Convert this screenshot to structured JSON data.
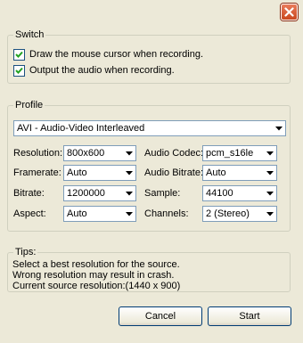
{
  "switch": {
    "legend": "Switch",
    "options": [
      {
        "label": "Draw the mouse cursor when recording.",
        "checked": true
      },
      {
        "label": "Output the audio when recording.",
        "checked": true
      }
    ]
  },
  "profile": {
    "legend": "Profile",
    "format": "AVI - Audio-Video Interleaved",
    "resolution": {
      "label": "Resolution:",
      "value": "800x600"
    },
    "framerate": {
      "label": "Framerate:",
      "value": "Auto"
    },
    "bitrate": {
      "label": "Bitrate:",
      "value": "1200000"
    },
    "aspect": {
      "label": "Aspect:",
      "value": "Auto"
    },
    "audio_codec": {
      "label": "Audio Codec:",
      "value": "pcm_s16le"
    },
    "audio_bitrate": {
      "label": "Audio Bitrate:",
      "value": "Auto"
    },
    "sample": {
      "label": "Sample:",
      "value": "44100"
    },
    "channels": {
      "label": "Channels:",
      "value": "2 (Stereo)"
    }
  },
  "tips": {
    "legend": "Tips:",
    "lines": [
      "Select a best resolution for the source.",
      "Wrong resolution may result in crash.",
      "Current source resolution:(1440 x 900)"
    ]
  },
  "buttons": {
    "cancel": "Cancel",
    "start": "Start"
  },
  "icons": {
    "close": "close-icon",
    "checkbox": "checkmark-icon",
    "dropdown": "chevron-down-icon"
  }
}
